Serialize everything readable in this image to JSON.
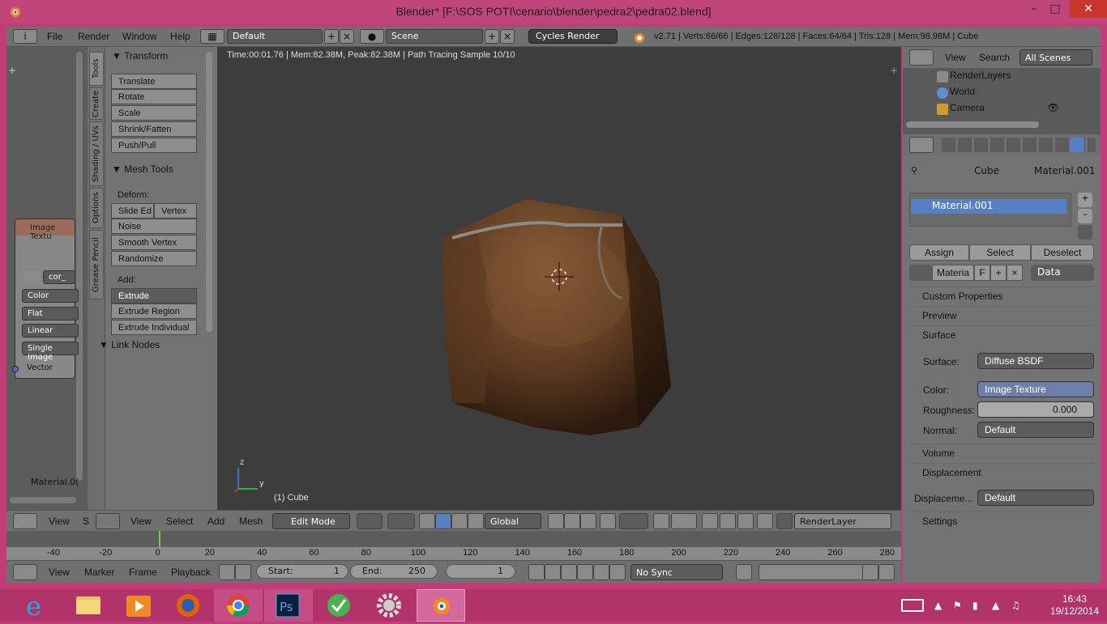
{
  "window": {
    "title": "Blender* [F:\\SOS POTI\\cenario\\blender\\pedra2\\pedra02.blend]"
  },
  "info": {
    "menus": [
      "File",
      "Render",
      "Window",
      "Help"
    ],
    "layout": "Default",
    "scene": "Scene",
    "engine": "Cycles Render",
    "stats": "v2.71 | Verts:66/66 | Edges:128/128 | Faces:64/64 | Tris:128 | Mem:98.98M | Cube"
  },
  "node_editor": {
    "node_title": "Image Textu",
    "image_name": "cor_",
    "fields": [
      "Color",
      "Flat",
      "Linear",
      "Single Image"
    ],
    "socket": "Vector",
    "material_label": "Material.0("
  },
  "toolshelf": {
    "tabs": [
      "Tools",
      "Create",
      "Shading / UVs",
      "Options",
      "Grease Pencil"
    ],
    "transform_title": "Transform",
    "transform": [
      "Translate",
      "Rotate",
      "Scale",
      "Shrink/Fatten",
      "Push/Pull"
    ],
    "mesh_tools_title": "Mesh Tools",
    "deform_label": "Deform:",
    "slide_edge": "Slide Ed",
    "vertex": "Vertex",
    "deform": [
      "Noise",
      "Smooth Vertex",
      "Randomize"
    ],
    "add_label": "Add:",
    "extrude": "Extrude",
    "add": [
      "Extrude Region",
      "Extrude Individual"
    ],
    "link_nodes": "Link Nodes"
  },
  "viewport": {
    "render_info": "Time:00:01.76 | Mem:82.38M, Peak:82.38M | Path Tracing Sample 10/10",
    "object_label": "(1) Cube",
    "axis_z": "z",
    "axis_y": "y"
  },
  "header3d": {
    "node_menu": [
      "View",
      "S"
    ],
    "menus": [
      "View",
      "Select",
      "Add",
      "Mesh"
    ],
    "mode": "Edit Mode",
    "orientation": "Global",
    "render_layer": "RenderLayer"
  },
  "timeline": {
    "ticks": [
      "-40",
      "-20",
      "0",
      "20",
      "40",
      "60",
      "80",
      "100",
      "120",
      "140",
      "160",
      "180",
      "200",
      "220",
      "240",
      "260",
      "280"
    ],
    "menus": [
      "View",
      "Marker",
      "Frame",
      "Playback"
    ],
    "start_label": "Start:",
    "start": "1",
    "end_label": "End:",
    "end": "250",
    "current": "1",
    "sync": "No Sync"
  },
  "outliner": {
    "menus": [
      "View",
      "Search"
    ],
    "filter": "All Scenes",
    "rows": [
      "RenderLayers",
      "World",
      "Camera"
    ]
  },
  "properties": {
    "breadcrumb_object": "Cube",
    "breadcrumb_material": "Material.001",
    "slot": "Material.001",
    "assign": "Assign",
    "select": "Select",
    "deselect": "Deselect",
    "material_field": "Materia",
    "material_users": "F",
    "link": "Data",
    "sections": {
      "custom_props": "Custom Properties",
      "preview": "Preview",
      "surface": "Surface",
      "volume": "Volume",
      "displacement": "Displacement",
      "settings": "Settings"
    },
    "surface_label": "Surface:",
    "surface_value": "Diffuse BSDF",
    "color_label": "Color:",
    "color_value": "Image Texture",
    "roughness_label": "Roughness:",
    "roughness_value": "0.000",
    "normal_label": "Normal:",
    "normal_value": "Default",
    "displacement_label": "Displaceme...",
    "displacement_value": "Default"
  },
  "taskbar": {
    "time": "16:43",
    "date": "19/12/2014"
  },
  "colors": {
    "accent": "#c0457a",
    "selected": "#5680c2",
    "viewport_bg": "#3d3d3d"
  }
}
